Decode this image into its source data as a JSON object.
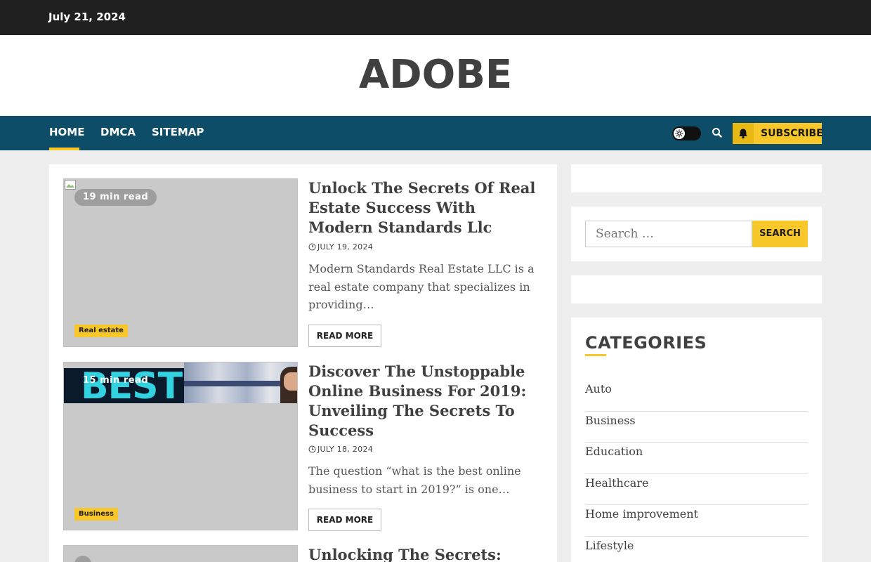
{
  "topbar": {
    "date": "July 21, 2024"
  },
  "site": {
    "title": "ADOBE"
  },
  "nav": {
    "items": [
      {
        "label": "HOME"
      },
      {
        "label": "DMCA"
      },
      {
        "label": "SITEMAP"
      }
    ],
    "subscribe_label": "SUBSCRIBE"
  },
  "posts": [
    {
      "read_time": "19 min read",
      "category": "Real estate",
      "title": "Unlock The Secrets Of Real Estate Success With Modern Standards Llc",
      "date": "JULY 19, 2024",
      "excerpt": "Modern Standards Real Estate LLC is a real estate company that specializes in providing…",
      "read_more": "READ MORE"
    },
    {
      "read_time": "15 min read",
      "category": "Business",
      "title": "Discover The Unstoppable Online Business For 2019: Unveiling The Secrets To Success",
      "date": "JULY 18, 2024",
      "excerpt": "The question “what is the best online business to start in 2019?” is one…",
      "read_more": "READ MORE",
      "image_text": "BEST"
    },
    {
      "title": "Unlocking The Secrets:"
    }
  ],
  "sidebar": {
    "search": {
      "placeholder": "Search …",
      "button": "SEARCH"
    },
    "categories": {
      "heading": "CATEGORIES",
      "items": [
        "Auto",
        "Business",
        "Education",
        "Healthcare",
        "Home improvement",
        "Lifestyle"
      ]
    }
  },
  "colors": {
    "accent": "#f8c72a",
    "nav_bg": "#0e4d67",
    "topbar_bg": "#202020"
  }
}
